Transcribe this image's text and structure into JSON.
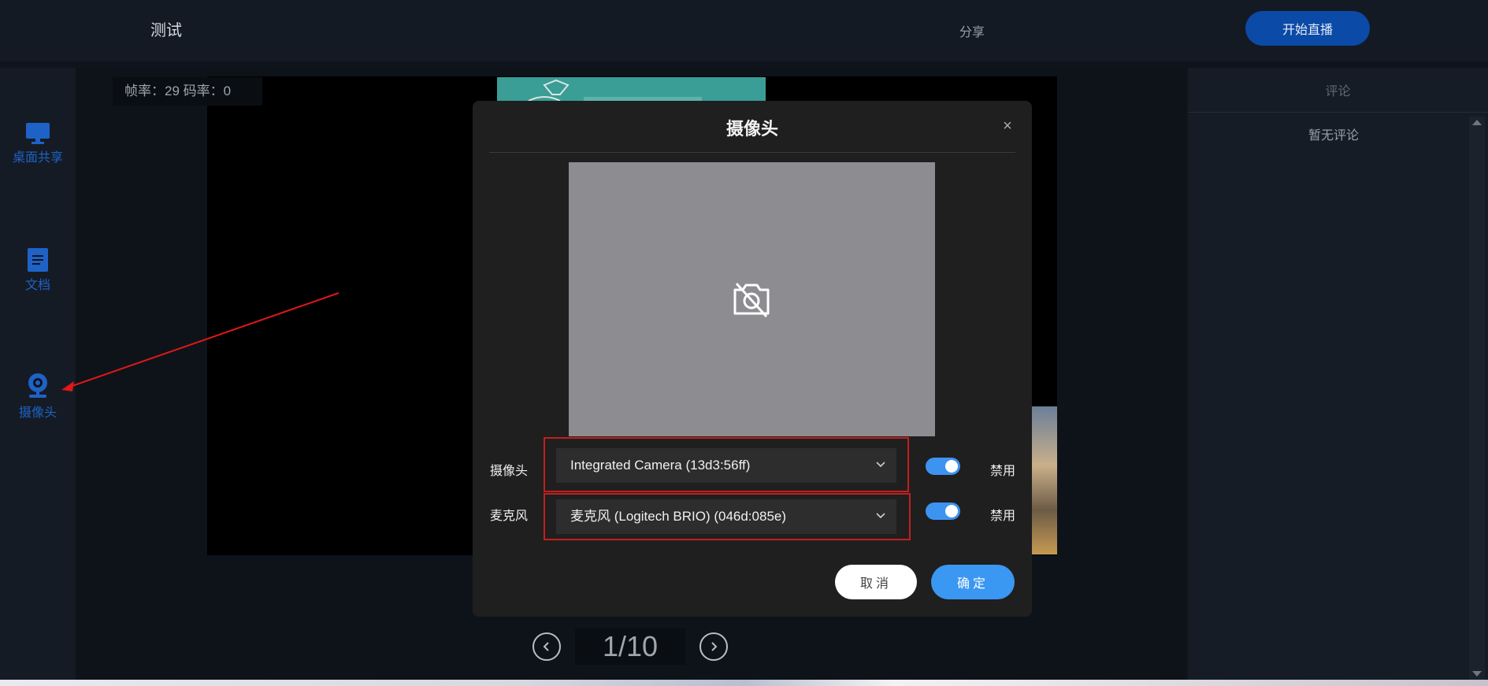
{
  "header": {
    "title": "测试",
    "share_label": "分享",
    "start_live_label": "开始直播"
  },
  "sidebar": {
    "items": [
      {
        "label": "桌面共享",
        "icon": "monitor-icon"
      },
      {
        "label": "文档",
        "icon": "document-icon"
      },
      {
        "label": "摄像头",
        "icon": "webcam-icon"
      }
    ]
  },
  "stage": {
    "stats": "帧率：29 码率：0",
    "page_indicator": "1/10"
  },
  "comments": {
    "title": "评论",
    "empty_text": "暂无评论"
  },
  "modal": {
    "title": "摄像头",
    "close_glyph": "×",
    "camera": {
      "label": "摄像头",
      "selected": "Integrated Camera (13d3:56ff)",
      "toggle_label": "禁用",
      "enabled": true
    },
    "microphone": {
      "label": "麦克风",
      "selected": "麦克风 (Logitech BRIO) (046d:085e)",
      "toggle_label": "禁用",
      "enabled": true
    },
    "cancel_label": "取消",
    "confirm_label": "确定"
  },
  "colors": {
    "accent": "#3a97f2",
    "start_button": "#0b4aa6",
    "annotation": "#e01818"
  }
}
